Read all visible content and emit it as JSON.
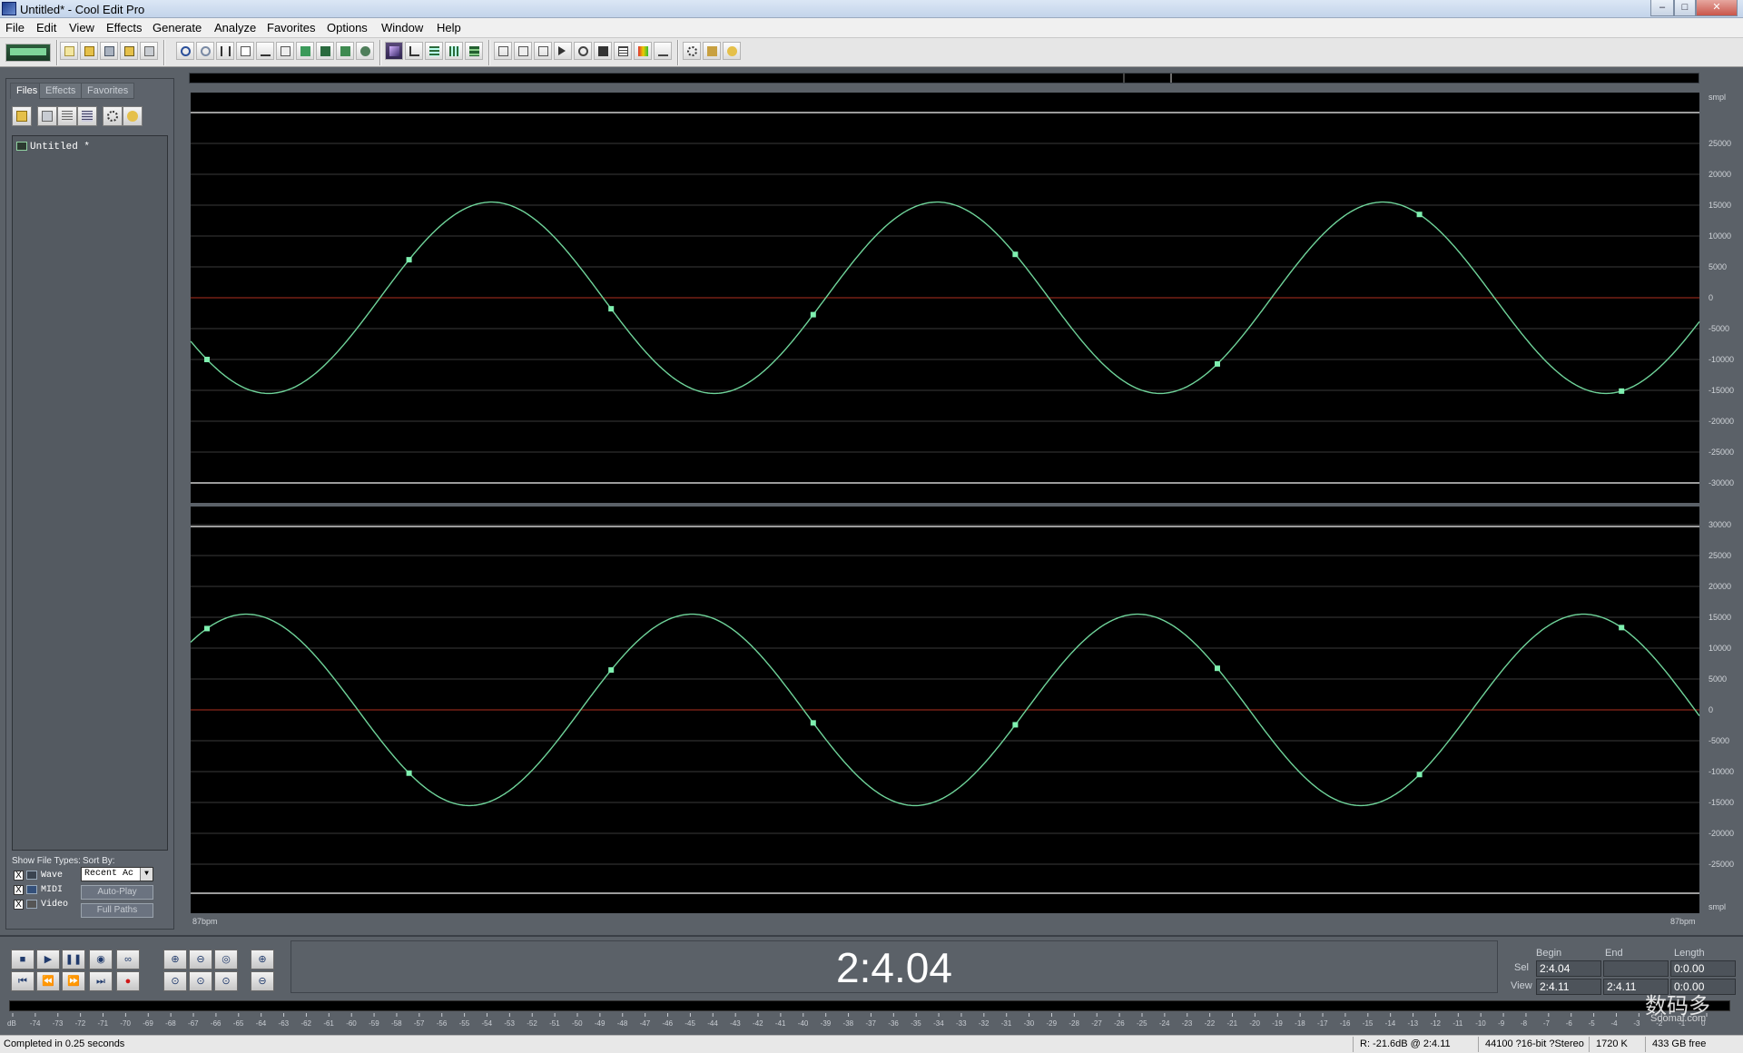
{
  "window": {
    "title": "Untitled* - Cool Edit Pro",
    "controls": {
      "minimize": "–",
      "maximize": "□",
      "close": "✕"
    }
  },
  "menu": [
    "File",
    "Edit",
    "View",
    "Effects",
    "Generate",
    "Analyze",
    "Favorites",
    "Options",
    "Window",
    "Help"
  ],
  "left_panel": {
    "tabs": [
      "Files",
      "Effects",
      "Favorites"
    ],
    "files": [
      {
        "name": "Untitled *"
      }
    ],
    "show_types_label": "Show File Types:",
    "sort_label": "Sort By:",
    "types": [
      {
        "label": "Wave",
        "checked": "X"
      },
      {
        "label": "MIDI",
        "checked": "X"
      },
      {
        "label": "Video",
        "checked": "X"
      }
    ],
    "sort_value": "Recent Ac",
    "autoplay_label": "Auto-Play",
    "fullpaths_label": "Full Paths"
  },
  "editor": {
    "top_unit": "smpl",
    "bottom_unit": "smpl",
    "bpm_left": "87bpm",
    "bpm_right": "87bpm",
    "amplitude_ticks": [
      "25000",
      "20000",
      "15000",
      "10000",
      "5000",
      "0",
      "-5000",
      "-10000",
      "-15000",
      "-20000",
      "-25000",
      "-30000"
    ],
    "amplitude_ticks_bottom": [
      "30000",
      "25000",
      "20000",
      "15000",
      "10000",
      "5000",
      "0",
      "-5000",
      "-10000",
      "-15000",
      "-20000",
      "-25000"
    ],
    "channel_top_amplitude": 15500,
    "channel_bottom_amplitude": 15500
  },
  "transport": {
    "time": "2:4.04",
    "sel_panel": {
      "headers": {
        "begin": "Begin",
        "end": "End",
        "length": "Length"
      },
      "sel_label": "Sel",
      "view_label": "View",
      "sel_begin": "2:4.04",
      "sel_end": "",
      "sel_length": "0:0.00",
      "view_begin": "2:4.11",
      "view_end": "2:4.11",
      "view_length": "0:0.00"
    }
  },
  "meter_ticks": [
    "dB",
    "-74",
    "-73",
    "-72",
    "-71",
    "-70",
    "-69",
    "-68",
    "-67",
    "-66",
    "-65",
    "-64",
    "-63",
    "-62",
    "-61",
    "-60",
    "-59",
    "-58",
    "-57",
    "-56",
    "-55",
    "-54",
    "-53",
    "-52",
    "-51",
    "-50",
    "-49",
    "-48",
    "-47",
    "-46",
    "-45",
    "-44",
    "-43",
    "-42",
    "-41",
    "-40",
    "-39",
    "-38",
    "-37",
    "-36",
    "-35",
    "-34",
    "-33",
    "-32",
    "-31",
    "-30",
    "-29",
    "-28",
    "-27",
    "-26",
    "-25",
    "-24",
    "-23",
    "-22",
    "-21",
    "-20",
    "-19",
    "-18",
    "-17",
    "-16",
    "-15",
    "-14",
    "-13",
    "-12",
    "-11",
    "-10",
    "-9",
    "-8",
    "-7",
    "-6",
    "-5",
    "-4",
    "-3",
    "-2",
    "-1",
    "0"
  ],
  "status": {
    "message": "Completed in 0.25 seconds",
    "level": "R: -21.6dB @ 2:4.11",
    "format": "44100 ?16-bit ?Stereo",
    "size": "1720 K",
    "free": "433 GB free"
  },
  "watermark": {
    "main": "数码多",
    "sub": "Soomal.com"
  },
  "colors": {
    "waveform": "#6fd49a",
    "zero_line": "#b03020",
    "grid": "#3a3a3a",
    "background": "#000000",
    "panel": "#5b6168"
  }
}
